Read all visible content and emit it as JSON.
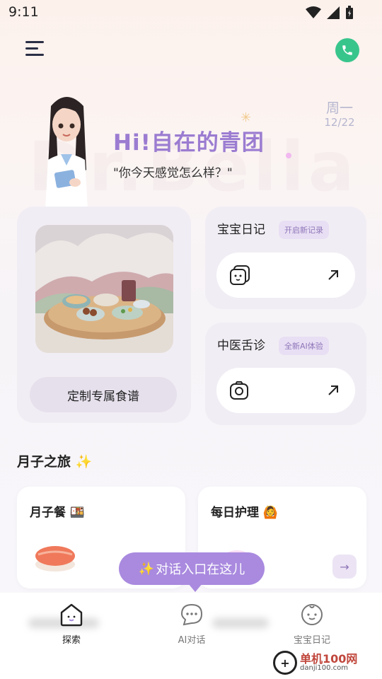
{
  "status": {
    "time": "9:11"
  },
  "header": {
    "weekday": "周一",
    "date": "12/22",
    "greeting": "Hi!自在的青团",
    "subgreeting": "\"你今天感觉怎么样？\""
  },
  "cards": {
    "food": {
      "button_label": "定制专属食谱"
    },
    "diary": {
      "title": "宝宝日记",
      "tag": "开启新记录"
    },
    "tongue": {
      "title": "中医舌诊",
      "tag": "全新AI体验"
    }
  },
  "journey": {
    "title": "月子之旅",
    "items": [
      {
        "label": "月子餐",
        "emoji": "🍱"
      },
      {
        "label": "每日护理",
        "emoji": "🙆"
      }
    ]
  },
  "chat_prompt": "对话入口在这儿",
  "nav": {
    "items": [
      {
        "label": "探索",
        "active": true
      },
      {
        "label": "AI对话",
        "active": false
      },
      {
        "label": "宝宝日记",
        "active": false
      }
    ]
  },
  "watermark": {
    "name": "单机100网",
    "url": "danji100.com"
  },
  "colors": {
    "accent": "#9b7cd1",
    "phone": "#38c58c",
    "bubble": "#a98adf"
  }
}
